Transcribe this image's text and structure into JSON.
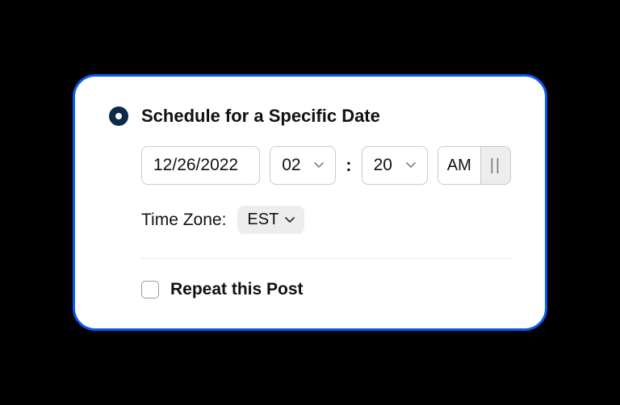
{
  "schedule": {
    "radio_label": "Schedule for a Specific Date",
    "date_value": "12/26/2022",
    "hour_value": "02",
    "minute_value": "20",
    "ampm_active": "AM",
    "ampm_inactive": "||",
    "timezone_label": "Time Zone:",
    "timezone_value": "EST",
    "repeat_label": "Repeat this Post"
  }
}
